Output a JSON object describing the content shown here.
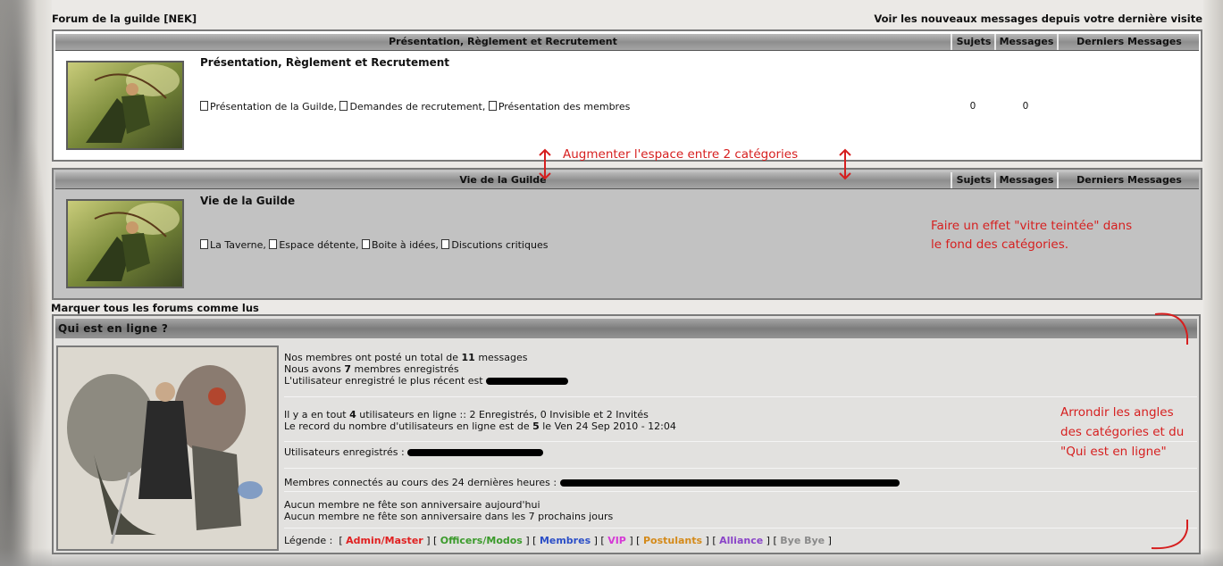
{
  "topbar": {
    "forum_name": "Forum de la guilde [NEK]",
    "new_messages_link": "Voir les nouveaux messages depuis votre dernière visite"
  },
  "columns": {
    "sujets": "Sujets",
    "messages": "Messages",
    "derniers": "Derniers Messages"
  },
  "categories": [
    {
      "header": "Présentation, Règlement et Recrutement",
      "forum_title": "Présentation, Règlement et Recrutement",
      "subforums": [
        "Présentation de la Guilde",
        "Demandes de recrutement",
        "Présentation des membres"
      ],
      "sujets": "0",
      "messages": "0"
    },
    {
      "header": "Vie de la Guilde",
      "forum_title": "Vie de la Guilde",
      "subforums": [
        "La Taverne",
        "Espace détente",
        "Boite à idées",
        "Discutions critiques"
      ]
    }
  ],
  "mark_all_read": "Marquer tous les forums comme lus",
  "whois": {
    "title": "Qui est en ligne ?",
    "posts_line_pre": "Nos membres ont posté un total de",
    "posts_count": "11",
    "posts_line_post": "messages",
    "members_line_pre": "Nous avons",
    "members_count": "7",
    "members_line_post": "membres enregistrés",
    "latest_member_line": "L'utilisateur enregistré le plus récent est",
    "online_pre": "Il y a en tout",
    "online_count": "4",
    "online_post": "utilisateurs en ligne :: 2 Enregistrés, 0 Invisible et 2 Invités",
    "record_pre": "Le record du nombre d'utilisateurs en ligne est de",
    "record_count": "5",
    "record_post": "le Ven 24 Sep 2010 - 12:04",
    "registered_users_label": "Utilisateurs enregistrés :",
    "last24_label": "Membres connectés au cours des 24 dernières heures :",
    "birthday_today": "Aucun membre ne fête son anniversaire aujourd'hui",
    "birthday_week": "Aucun membre ne fête son anniversaire dans les 7 prochains jours",
    "legend_label": "Légende :",
    "legend": [
      {
        "label": "Admin/Master",
        "color": "#e02020"
      },
      {
        "label": "Officers/Modos",
        "color": "#3a9a2a"
      },
      {
        "label": "Membres",
        "color": "#2c4fc7"
      },
      {
        "label": "VIP",
        "color": "#d63ad6"
      },
      {
        "label": "Postulants",
        "color": "#d48a1a"
      },
      {
        "label": "Alliance",
        "color": "#8a44c8"
      },
      {
        "label": "Bye Bye",
        "color": "#8a8a8a"
      }
    ]
  },
  "annotations": {
    "spacing": "Augmenter l'espace entre 2 catégories",
    "glass_line1": "Faire un effet \"vitre teintée\" dans",
    "glass_line2": "le fond des catégories.",
    "round_line1": "Arrondir les angles",
    "round_line2": "des catégories et du",
    "round_line3": "\"Qui est en ligne\"",
    "color": "#d61f1f"
  }
}
